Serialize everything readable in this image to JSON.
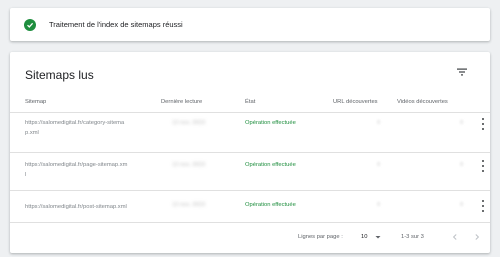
{
  "toast": {
    "message": "Traitement de l'index de sitemaps réussi",
    "icon": "check-circle-icon",
    "color": "#1e8e3e"
  },
  "sitemaps": {
    "title": "Sitemaps lus",
    "columns": {
      "sitemap": "Sitemap",
      "last_read": "Dernière lecture",
      "state": "État",
      "urls": "URL découvertes",
      "videos": "Vidéos découvertes"
    },
    "rows": [
      {
        "url_line1": "https://salomedigital.fr/category-sitema",
        "url_line2": "p.xml",
        "last_read": "12 nov. 2023",
        "state": "Opération effectuée",
        "urls": "0",
        "videos": "0"
      },
      {
        "url_line1": "https://salomedigital.fr/page-sitemap.xm",
        "url_line2": "l",
        "last_read": "12 nov. 2023",
        "state": "Opération effectuée",
        "urls": "0",
        "videos": "0"
      },
      {
        "url_line1": "https://salomedigital.fr/post-sitemap.xml",
        "url_line2": "",
        "last_read": "12 nov. 2023",
        "state": "Opération effectuée",
        "urls": "0",
        "videos": "0"
      }
    ],
    "pagination": {
      "rows_per_page_label": "Lignes par page :",
      "rows_per_page_value": "10",
      "range": "1-3 sur 3"
    }
  }
}
